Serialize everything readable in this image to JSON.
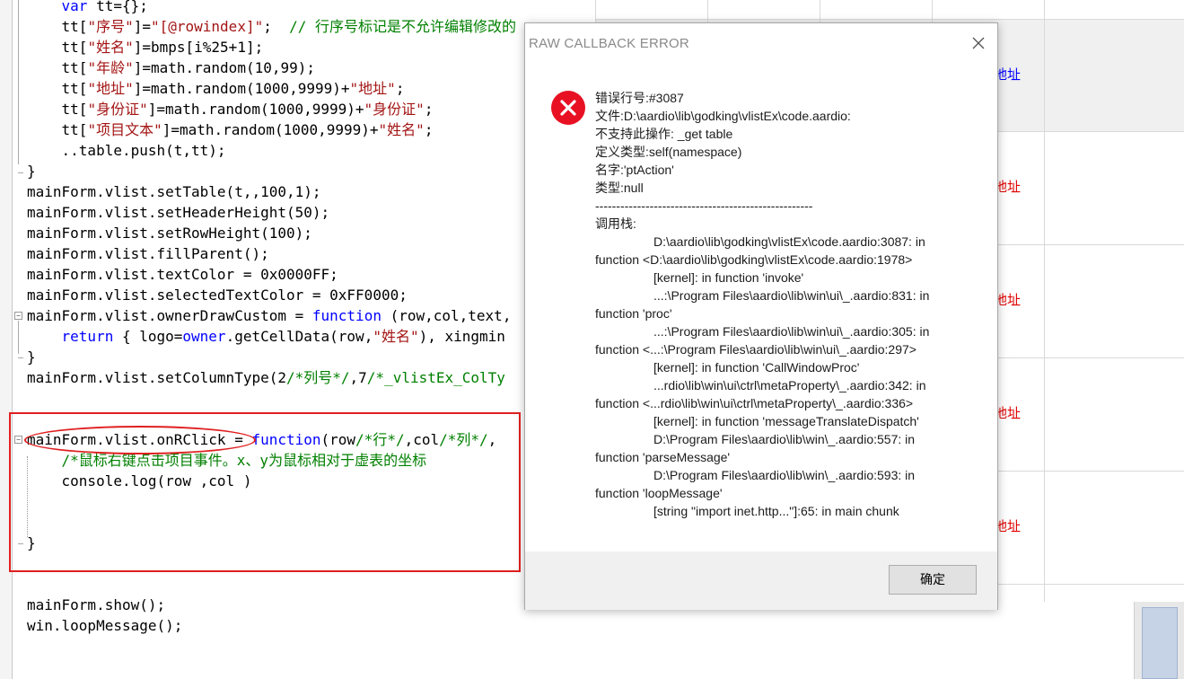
{
  "editor": {
    "lines": [
      [
        {
          "t": "    "
        },
        {
          "t": "var",
          "c": "kw"
        },
        {
          "t": " tt={};"
        }
      ],
      [
        {
          "t": "    tt["
        },
        {
          "t": "\"序号\"",
          "c": "str"
        },
        {
          "t": "]="
        },
        {
          "t": "\"[@rowindex]\"",
          "c": "str"
        },
        {
          "t": ";  "
        },
        {
          "t": "// 行序号标记是不允许编辑修改的",
          "c": "cm"
        }
      ],
      [
        {
          "t": "    tt["
        },
        {
          "t": "\"姓名\"",
          "c": "str"
        },
        {
          "t": "]=bmps[i%25+1];"
        }
      ],
      [
        {
          "t": "    tt["
        },
        {
          "t": "\"年龄\"",
          "c": "str"
        },
        {
          "t": "]=math.random(10,99);"
        }
      ],
      [
        {
          "t": "    tt["
        },
        {
          "t": "\"地址\"",
          "c": "str"
        },
        {
          "t": "]=math.random(1000,9999)+"
        },
        {
          "t": "\"地址\"",
          "c": "str"
        },
        {
          "t": ";"
        }
      ],
      [
        {
          "t": "    tt["
        },
        {
          "t": "\"身份证\"",
          "c": "str"
        },
        {
          "t": "]=math.random(1000,9999)+"
        },
        {
          "t": "\"身份证\"",
          "c": "str"
        },
        {
          "t": ";"
        }
      ],
      [
        {
          "t": "    tt["
        },
        {
          "t": "\"项目文本\"",
          "c": "str"
        },
        {
          "t": "]=math.random(1000,9999)+"
        },
        {
          "t": "\"姓名\"",
          "c": "str"
        },
        {
          "t": ";"
        }
      ],
      [
        {
          "t": "    ..table.push(t,tt);"
        }
      ],
      [
        {
          "t": "}"
        }
      ],
      [
        {
          "t": "mainForm.vlist.setTable(t,,100,1);"
        }
      ],
      [
        {
          "t": "mainForm.vlist.setHeaderHeight(50);"
        }
      ],
      [
        {
          "t": "mainForm.vlist.setRowHeight(100);"
        }
      ],
      [
        {
          "t": "mainForm.vlist.fillParent();"
        }
      ],
      [
        {
          "t": "mainForm.vlist.textColor = 0x0000FF;"
        }
      ],
      [
        {
          "t": "mainForm.vlist.selectedTextColor = 0xFF0000;"
        }
      ],
      [
        {
          "t": "mainForm.vlist.ownerDrawCustom = "
        },
        {
          "t": "function",
          "c": "kw"
        },
        {
          "t": " (row,col,text,"
        }
      ],
      [
        {
          "t": "    "
        },
        {
          "t": "return",
          "c": "kw"
        },
        {
          "t": " { logo="
        },
        {
          "t": "owner",
          "c": "kw"
        },
        {
          "t": ".getCellData(row,"
        },
        {
          "t": "\"姓名\"",
          "c": "str"
        },
        {
          "t": "), xingmin"
        }
      ],
      [
        {
          "t": "}"
        }
      ],
      [
        {
          "t": "mainForm.vlist.setColumnType(2"
        },
        {
          "t": "/*列号*/",
          "c": "cm"
        },
        {
          "t": ",7"
        },
        {
          "t": "/*_vlistEx_ColTy",
          "c": "cm"
        }
      ],
      [
        {
          "t": ""
        }
      ],
      [
        {
          "t": ""
        }
      ],
      [
        {
          "t": "mainForm.vlist.onRClick = "
        },
        {
          "t": "function",
          "c": "kw"
        },
        {
          "t": "(row"
        },
        {
          "t": "/*行*/",
          "c": "cm"
        },
        {
          "t": ",col"
        },
        {
          "t": "/*列*/",
          "c": "cm"
        },
        {
          "t": ","
        }
      ],
      [
        {
          "t": "    "
        },
        {
          "t": "/*鼠标右键点击项目事件。x、y为鼠标相对于虚表的坐标",
          "c": "cm"
        }
      ],
      [
        {
          "t": "    console.log(row ,col )"
        }
      ],
      [
        {
          "t": ""
        }
      ],
      [
        {
          "t": ""
        }
      ],
      [
        {
          "t": "}"
        }
      ],
      [
        {
          "t": ""
        }
      ],
      [
        {
          "t": ""
        }
      ],
      [
        {
          "t": "mainForm.show();"
        }
      ],
      [
        {
          "t": "win.loopMessage();"
        }
      ]
    ]
  },
  "grid": {
    "cell_text": "地址",
    "link_color": "#0000ff",
    "selected_color": "#e00000"
  },
  "dialog": {
    "title": "RAW CALLBACK ERROR",
    "icon": "error-icon",
    "close_icon": "close-icon",
    "message_lines": [
      "错误行号:#3087",
      "文件:D:\\aardio\\lib\\godking\\vlistEx\\code.aardio:",
      "不支持此操作: _get table",
      "定义类型:self(namespace)",
      "名字:'ptAction'",
      "类型:null",
      "----------------------------------------------------",
      "调用栈:",
      "\t\tD:\\aardio\\lib\\godking\\vlistEx\\code.aardio:3087: in",
      "function <D:\\aardio\\lib\\godking\\vlistEx\\code.aardio:1978>",
      "\t\t[kernel]: in function 'invoke'",
      "\t\t...:\\Program Files\\aardio\\lib\\win\\ui\\_.aardio:831: in",
      "function 'proc'",
      "\t\t...:\\Program Files\\aardio\\lib\\win\\ui\\_.aardio:305: in",
      "function <...:\\Program Files\\aardio\\lib\\win\\ui\\_.aardio:297>",
      "\t\t[kernel]: in function 'CallWindowProc'",
      "\t\t...rdio\\lib\\win\\ui\\ctrl\\metaProperty\\_.aardio:342: in",
      "function <...rdio\\lib\\win\\ui\\ctrl\\metaProperty\\_.aardio:336>",
      "\t\t[kernel]: in function 'messageTranslateDispatch'",
      "\t\tD:\\Program Files\\aardio\\lib\\win\\_.aardio:557: in",
      "function 'parseMessage'",
      "\t\tD:\\Program Files\\aardio\\lib\\win\\_.aardio:593: in",
      "function 'loopMessage'",
      "\t\t[string \"import inet.http...\"]:65: in main chunk"
    ],
    "ok_label": "确定"
  }
}
